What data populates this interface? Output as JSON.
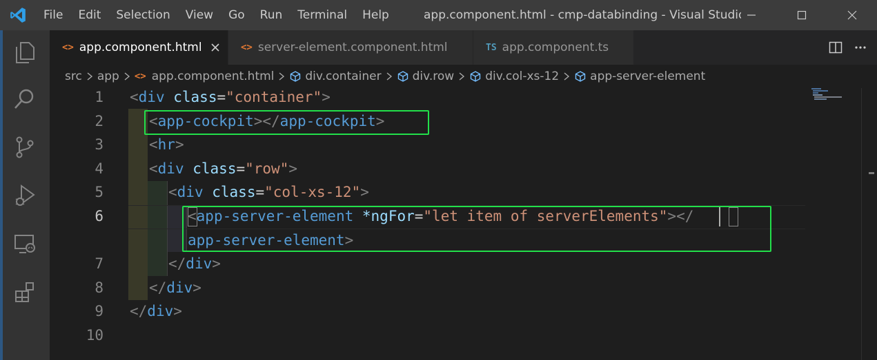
{
  "titlebar": {
    "menu": [
      "File",
      "Edit",
      "Selection",
      "View",
      "Go",
      "Run",
      "Terminal",
      "Help"
    ],
    "window_title": "app.component.html - cmp-databinding - Visual Studio C..."
  },
  "activitybar": {
    "items": [
      "files-icon",
      "search-icon",
      "source-control-icon",
      "run-debug-icon",
      "remote-explorer-icon",
      "extensions-icon"
    ]
  },
  "tabs": [
    {
      "label": "app.component.html",
      "icon": "<>",
      "active": true
    },
    {
      "label": "server-element.component.html",
      "icon": "<>",
      "active": false
    },
    {
      "label": "app.component.ts",
      "icon": "TS",
      "active": false
    }
  ],
  "breadcrumb": {
    "src": "src",
    "app": "app",
    "file": "app.component.html",
    "file_icon": "<>",
    "div_container": "div.container",
    "div_row": "div.row",
    "div_col": "div.col-xs-12",
    "server_element": "app-server-element"
  },
  "editor": {
    "line_numbers": [
      "1",
      "2",
      "3",
      "4",
      "5",
      "6",
      "7",
      "8",
      "9",
      "10"
    ],
    "current_line": "6",
    "tokens": {
      "lt": "<",
      "gt": ">",
      "lt_slash": "</",
      "div": "div",
      "class_attr": "class",
      "eq": "=",
      "str_container": "\"container\"",
      "app_cockpit": "app-cockpit",
      "hr": "hr",
      "str_row": "\"row\"",
      "str_col": "\"col-xs-12\"",
      "app_server_element": "app-server-element",
      "ngfor_attr": "*ngFor",
      "ngfor_value": "\"let item of serverElements\"",
      "close_open": "></"
    }
  },
  "colors": {
    "highlight_box": "#22e04a",
    "tag": "#569cd6",
    "attribute": "#9cdcfe",
    "string": "#ce9178"
  }
}
